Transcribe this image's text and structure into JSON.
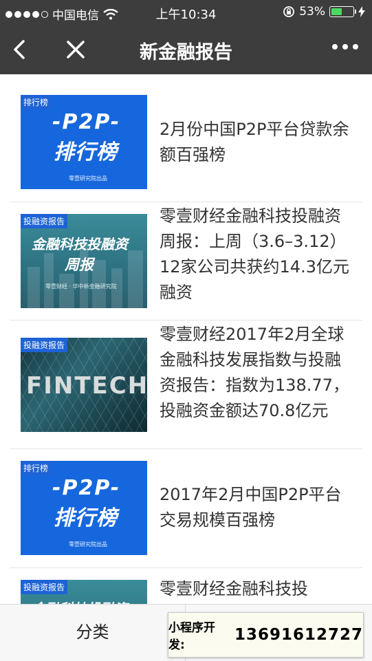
{
  "status_bar": {
    "carrier": "中国电信",
    "time": "上午10:34",
    "battery_percent": "53%",
    "battery_level": 0.53
  },
  "nav": {
    "title": "新金融报告"
  },
  "articles": [
    {
      "tag": "排行榜",
      "thumb": {
        "line1": "-P2P-",
        "line2": "排行榜",
        "credit": "零壹研究院出品"
      },
      "title": "2月份中国P2P平台贷款余额百强榜"
    },
    {
      "tag": "投融资报告",
      "thumb": {
        "line1": "金融科技投融资",
        "line2": "周报",
        "credit": "零壹财经 · 华中新金融研究院"
      },
      "title": "零壹财经金融科技投融资周报：上周（3.6–3.12）12家公司共获约14.3亿元融资"
    },
    {
      "tag": "投融资报告",
      "thumb": {
        "line1": "FINTECH"
      },
      "title": "零壹财经2017年2月全球金融科技发展指数与投融资报告：指数为138.77，投融资金额达70.8亿元"
    },
    {
      "tag": "排行榜",
      "thumb": {
        "line1": "-P2P-",
        "line2": "排行榜",
        "credit": "零壹研究院出品"
      },
      "title": "2017年2月中国P2P平台交易规模百强榜"
    },
    {
      "tag": "投融资报告",
      "thumb": {
        "line1": "金融科技投融资"
      },
      "title": "零壹财经金融科技投"
    }
  ],
  "tabbar": {
    "left_label": "分类"
  },
  "promo": {
    "label": "小程序开发:",
    "phone": "13691612727"
  },
  "colors": {
    "nav_bg": "#3d3d3d",
    "thumb_blue": "#1667dd",
    "battery_green": "#4cd964"
  }
}
